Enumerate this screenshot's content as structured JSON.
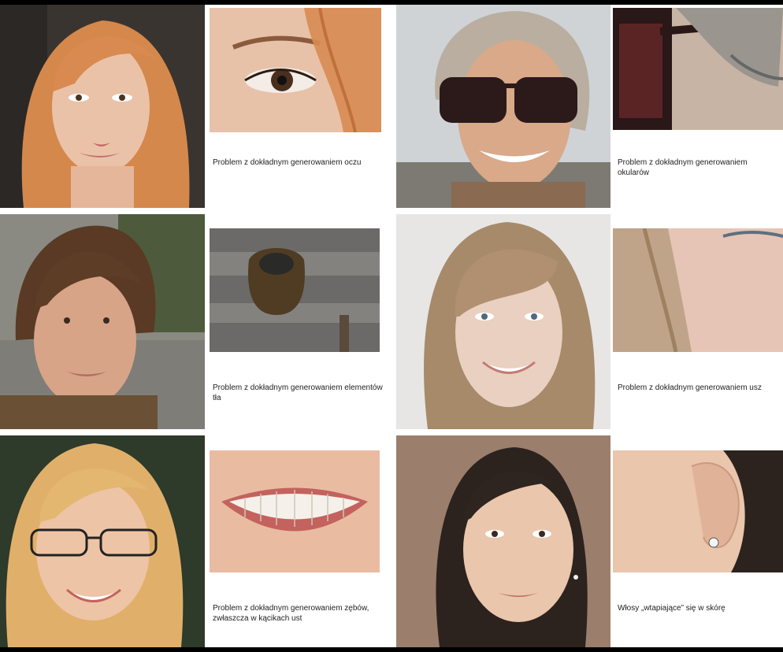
{
  "panels": [
    {
      "caption": "Problem z dokładnym generowaniem oczu",
      "face": "woman-red-hair-photo",
      "crop": "eye-closeup-photo"
    },
    {
      "caption": "Problem z dokładnym generowaniem okularów",
      "face": "man-sunglasses-photo",
      "crop": "glasses-closeup-photo"
    },
    {
      "caption": "Problem z dokładnym generowaniem elementów tła",
      "face": "woman-short-brown-hair-photo",
      "crop": "background-closeup-photo"
    },
    {
      "caption": "Problem z dokładnym generowaniem usz",
      "face": "woman-fringe-photo",
      "crop": "ear-closeup-photo"
    },
    {
      "caption": "Problem z dokładnym generowaniem zębów, zwłaszcza w kącikach ust",
      "face": "woman-glasses-photo",
      "crop": "teeth-closeup-photo"
    },
    {
      "caption": "Włosy „wtapiające” się w skórę",
      "face": "woman-dark-hair-photo",
      "crop": "earring-closeup-photo"
    }
  ]
}
